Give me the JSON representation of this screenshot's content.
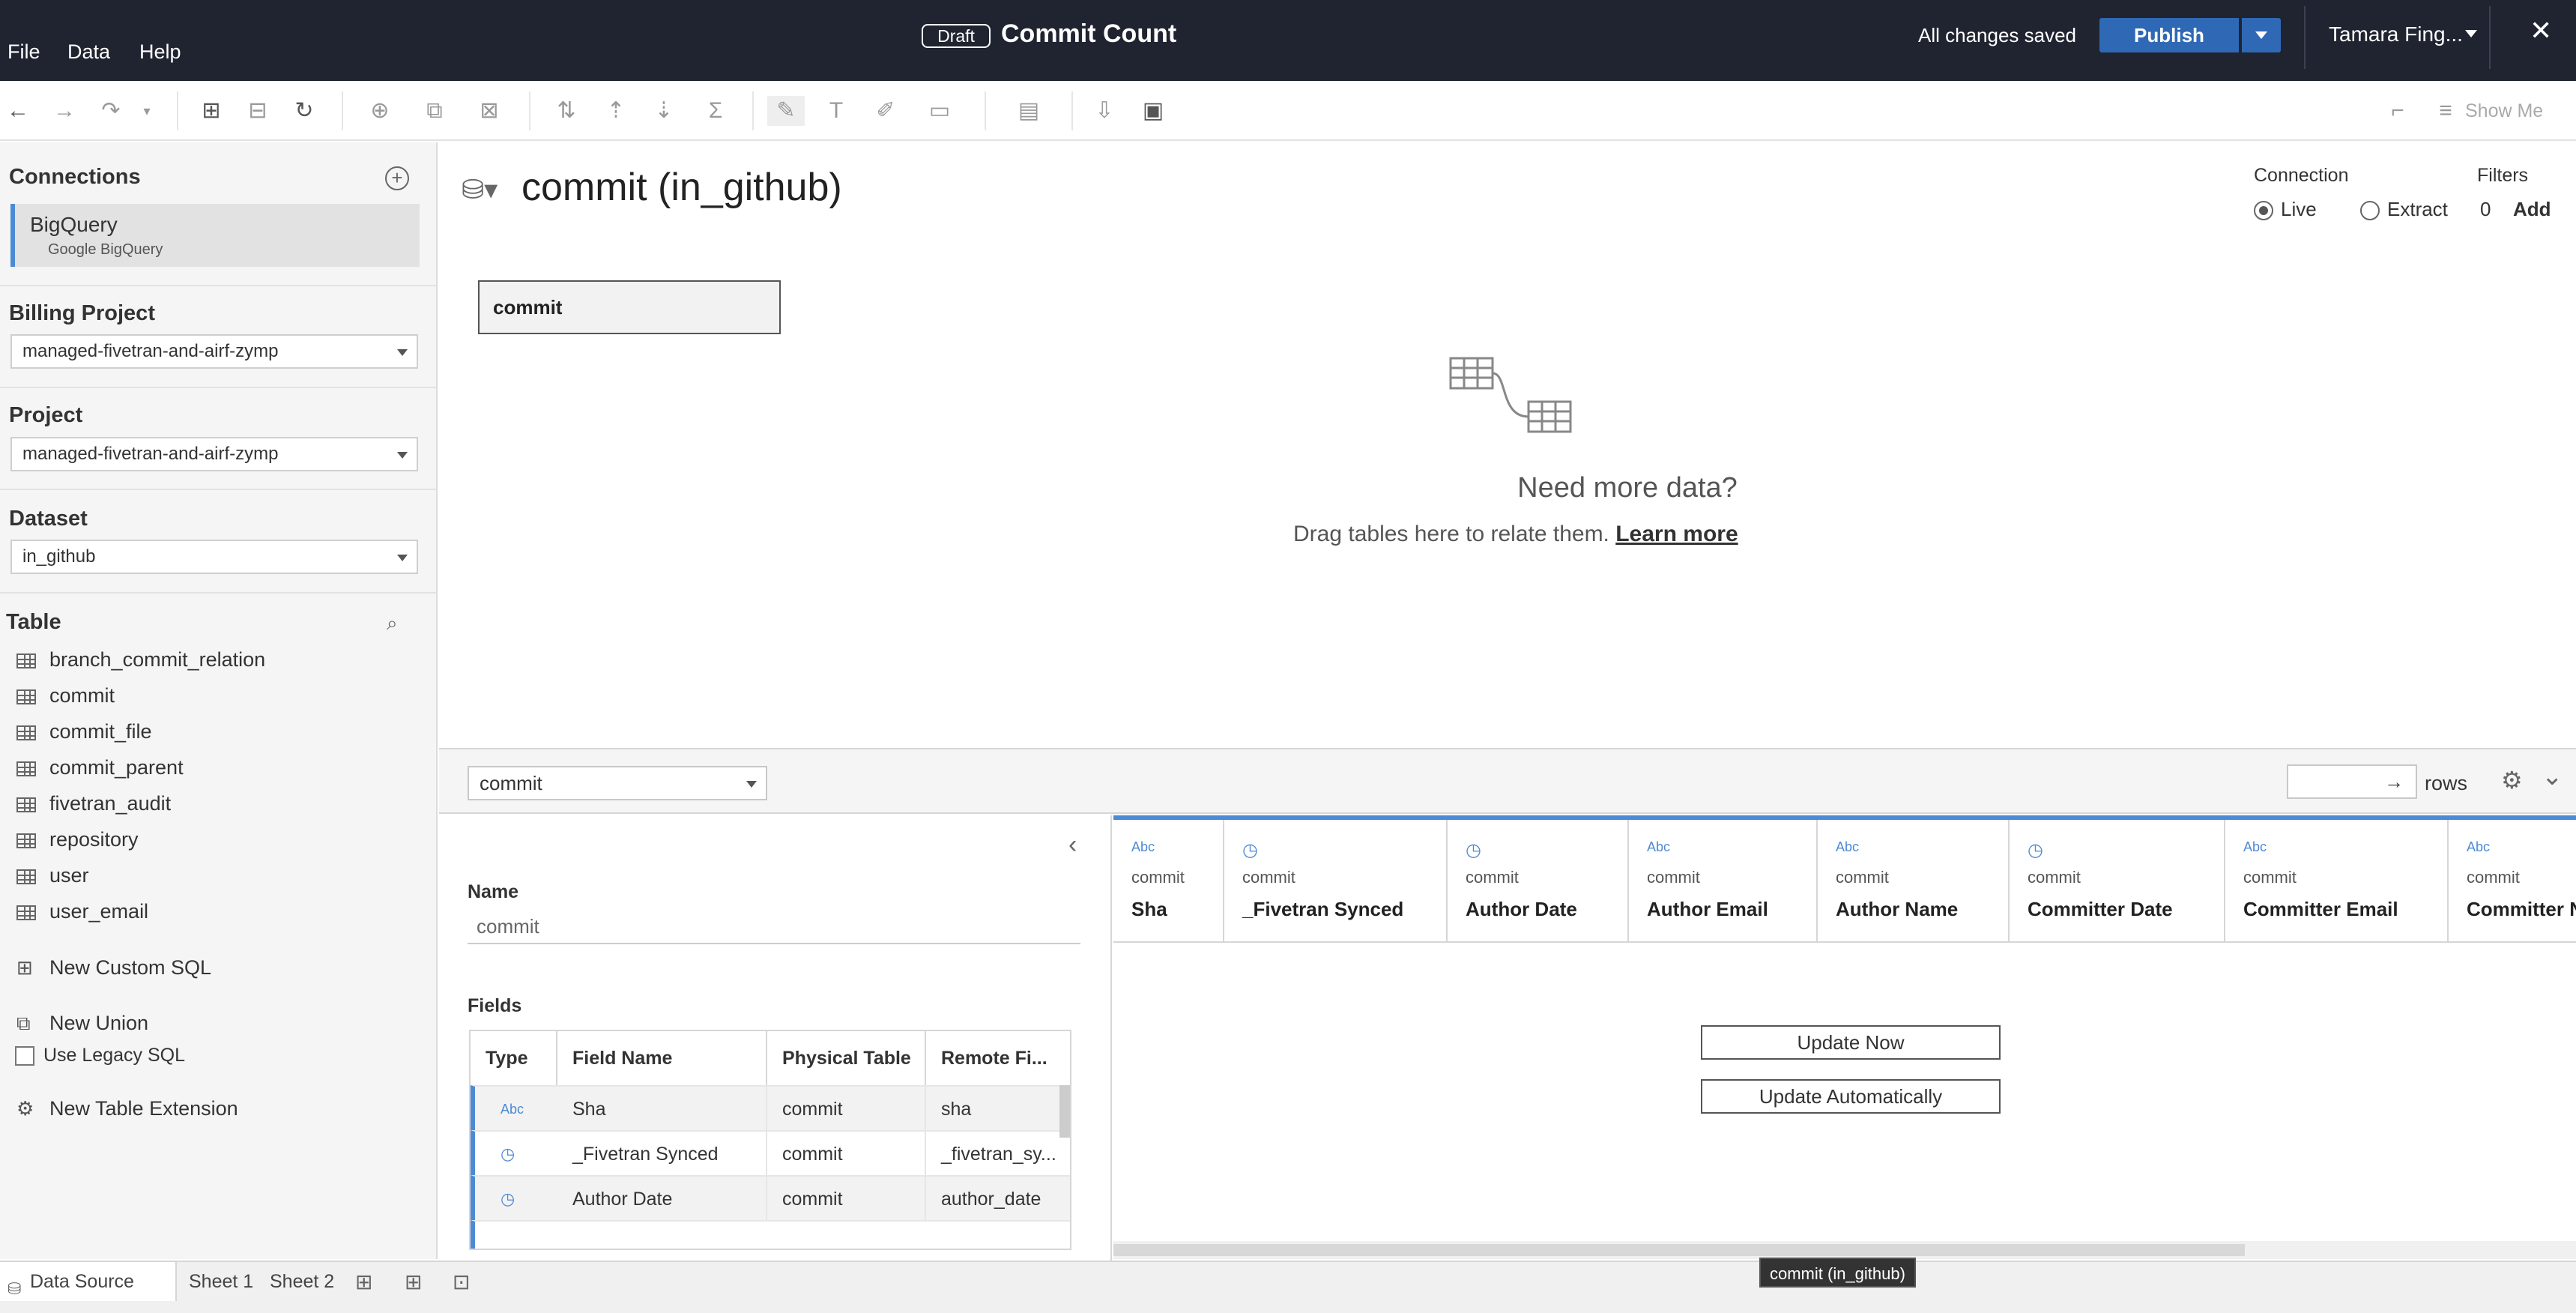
{
  "menu": {
    "file": "File",
    "data": "Data",
    "help": "Help"
  },
  "header": {
    "draft": "Draft",
    "title": "Commit Count",
    "saved": "All changes saved",
    "publish": "Publish",
    "user": "Tamara Fing..."
  },
  "toolbar": {
    "show_me": "Show Me"
  },
  "left": {
    "connections_title": "Connections",
    "connection_name": "BigQuery",
    "connection_sub": "Google BigQuery",
    "billing_title": "Billing Project",
    "billing_value": "managed-fivetran-and-airf-zymp",
    "project_title": "Project",
    "project_value": "managed-fivetran-and-airf-zymp",
    "dataset_title": "Dataset",
    "dataset_value": "in_github",
    "table_title": "Table",
    "tables": [
      "branch_commit_relation",
      "commit",
      "commit_file",
      "commit_parent",
      "fivetran_audit",
      "repository",
      "user",
      "user_email"
    ],
    "new_custom_sql": "New Custom SQL",
    "new_union": "New Union",
    "use_legacy_sql": "Use Legacy SQL",
    "new_table_extension": "New Table Extension"
  },
  "canvas": {
    "title": "commit (in_github)",
    "connection_label": "Connection",
    "live": "Live",
    "extract": "Extract",
    "filters_label": "Filters",
    "filters_count": "0",
    "filters_add": "Add",
    "table_box": "commit",
    "need_more": "Need more data?",
    "drag_text": "Drag tables here to relate them.",
    "learn_more": "Learn more"
  },
  "midbar": {
    "table_select": "commit",
    "rows_input": "",
    "rows_label": "rows"
  },
  "meta": {
    "name_label": "Name",
    "name_value": "commit",
    "fields_label": "Fields",
    "headers": [
      "Type",
      "Field Name",
      "Physical Table",
      "Remote Fi..."
    ],
    "rows": [
      {
        "type": "Abc",
        "field": "Sha",
        "table": "commit",
        "remote": "sha"
      },
      {
        "type": "date-time",
        "field": "_Fivetran Synced",
        "table": "commit",
        "remote": "_fivetran_sy..."
      },
      {
        "type": "date-time",
        "field": "Author Date",
        "table": "commit",
        "remote": "author_date"
      }
    ]
  },
  "grid": {
    "columns": [
      {
        "type": "Abc",
        "src": "commit",
        "name": "Sha"
      },
      {
        "type": "date-time",
        "src": "commit",
        "name": "_Fivetran Synced"
      },
      {
        "type": "date-time",
        "src": "commit",
        "name": "Author Date"
      },
      {
        "type": "Abc",
        "src": "commit",
        "name": "Author Email"
      },
      {
        "type": "Abc",
        "src": "commit",
        "name": "Author Name"
      },
      {
        "type": "date-time",
        "src": "commit",
        "name": "Committer Date"
      },
      {
        "type": "Abc",
        "src": "commit",
        "name": "Committer Email"
      },
      {
        "type": "Abc",
        "src": "commit",
        "name": "Committer N"
      }
    ],
    "update_now": "Update Now",
    "update_auto": "Update Automatically"
  },
  "tabs": {
    "data_source": "Data Source",
    "sheet1": "Sheet 1",
    "sheet2": "Sheet 2"
  },
  "tooltip": "commit (in_github)"
}
